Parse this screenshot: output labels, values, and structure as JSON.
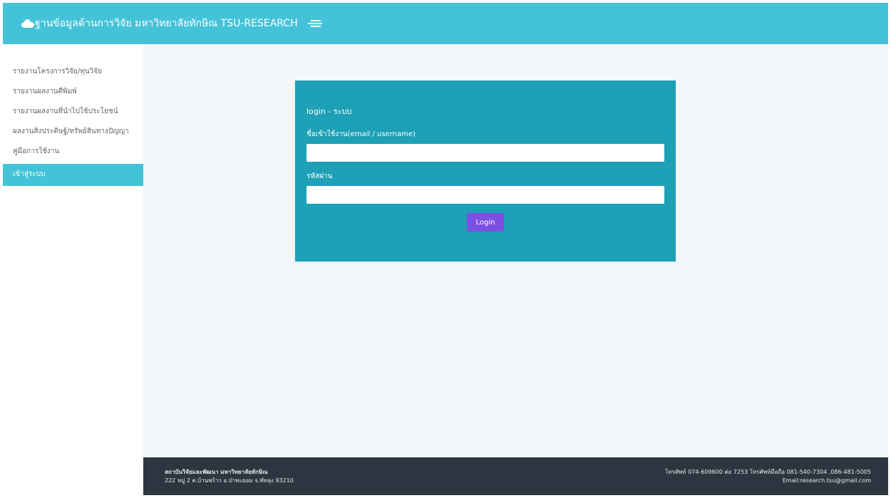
{
  "header": {
    "title": "ฐานข้อมูลด้านการวิจัย มหาวิทยาลัยทักษิณ TSU-RESEARCH",
    "logo_icon": "cloud-icon",
    "menu_icon": "menu-toggle-icon",
    "color": "#44c3d8"
  },
  "sidebar": {
    "items": [
      {
        "label": "รายงานโครงการวิจัย/ทุนวิจัย"
      },
      {
        "label": "รายงานผลงานตีพิมพ์"
      },
      {
        "label": "รายงานผลงานที่นำไปใช้ประโยชน์"
      },
      {
        "label": "ผลงานสิ่งประดิษฐ์/ทรัพย์สินทางปัญญา"
      },
      {
        "label": "คู่มือการใช้งาน"
      },
      {
        "label": "เข้าสู่ระบบ"
      }
    ],
    "active_index": 5
  },
  "login": {
    "title": "login - ระบบ",
    "username_label": "ชื่อเข้าใช้งาน(email / username)",
    "username_value": "",
    "password_label": "รหัสผ่าน",
    "password_value": "",
    "button_label": "Login",
    "card_color": "#1ea0b6",
    "button_color": "#7c4fe3"
  },
  "footer": {
    "org_name": "สถาบันวิจัยและพัฒนา มหาวิทยาลัยทักษิณ",
    "address": "222 หมู่ 2 ต.บ้านพร้าว อ.ป่าพะยอม จ.พัทลุง 93210",
    "phone": "โทรศัพท์ 074-609600 ต่อ 7253 โทรศัพท์มือถือ 081-540-7304 ,086-481-5005",
    "email": "Email:research.tsu@gmail.com"
  }
}
